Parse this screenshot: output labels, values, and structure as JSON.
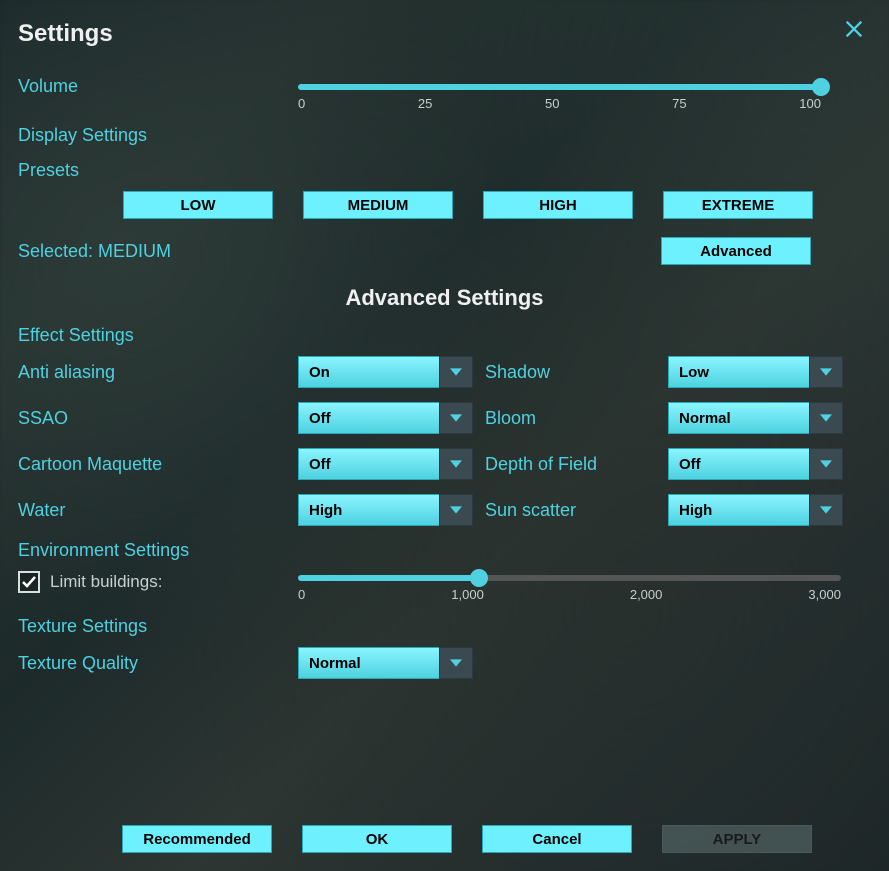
{
  "title": "Settings",
  "volume": {
    "label": "Volume",
    "value": 100,
    "ticks": [
      "0",
      "25",
      "50",
      "75",
      "100"
    ]
  },
  "display_settings_label": "Display Settings",
  "presets": {
    "label": "Presets",
    "buttons": [
      "LOW",
      "MEDIUM",
      "HIGH",
      "EXTREME"
    ],
    "selected_text": "Selected: MEDIUM",
    "advanced_button": "Advanced"
  },
  "advanced_title": "Advanced Settings",
  "effect_settings_label": "Effect Settings",
  "effects": {
    "anti_aliasing": {
      "label": "Anti aliasing",
      "value": "On"
    },
    "shadow": {
      "label": "Shadow",
      "value": "Low"
    },
    "ssao": {
      "label": "SSAO",
      "value": "Off"
    },
    "bloom": {
      "label": "Bloom",
      "value": "Normal"
    },
    "cartoon": {
      "label": "Cartoon Maquette",
      "value": "Off"
    },
    "dof": {
      "label": "Depth of Field",
      "value": "Off"
    },
    "water": {
      "label": "Water",
      "value": "High"
    },
    "sunscatter": {
      "label": "Sun scatter",
      "value": "High"
    }
  },
  "environment": {
    "label": "Environment Settings",
    "limit_buildings_label": "Limit buildings:",
    "limit_buildings_checked": true,
    "slider_value": 1000,
    "ticks": [
      "0",
      "1,000",
      "2,000",
      "3,000"
    ]
  },
  "texture": {
    "section_label": "Texture Settings",
    "quality_label": "Texture Quality",
    "quality_value": "Normal"
  },
  "bottom": {
    "recommended": "Recommended",
    "ok": "OK",
    "cancel": "Cancel",
    "apply": "APPLY"
  }
}
